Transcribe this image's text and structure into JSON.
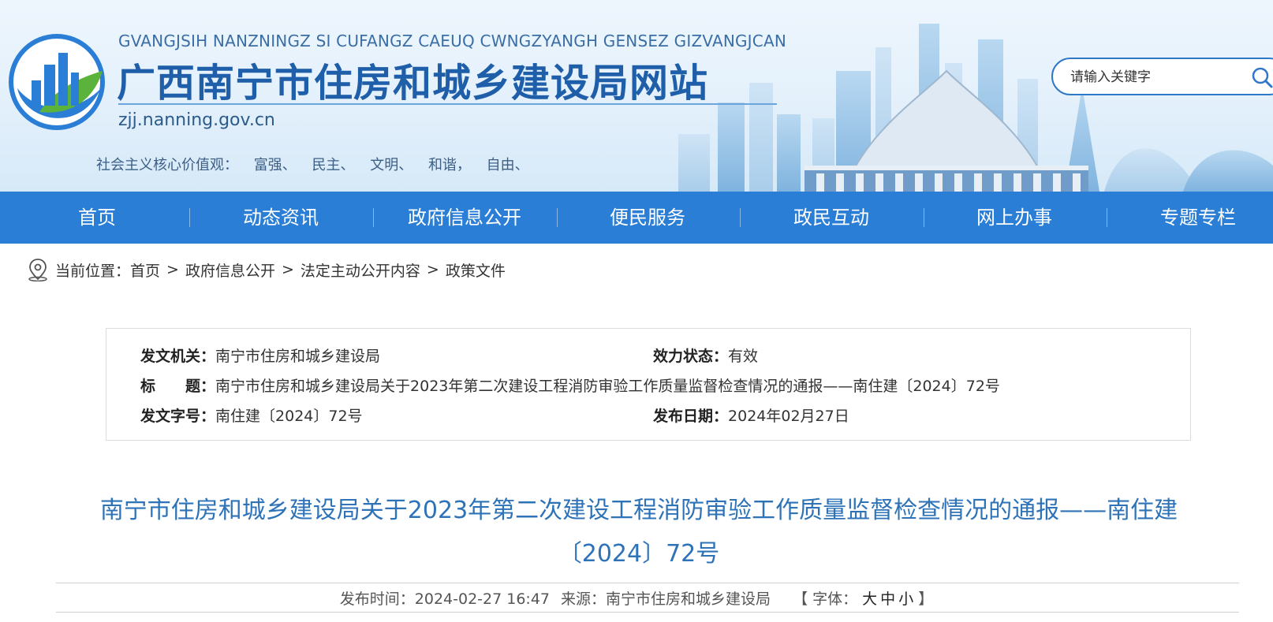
{
  "header": {
    "pinyin": "GVANGJSIH NANZNINGZ SI CUFANGZ CAEUQ CWNGZYANGH GENSEZ GIZVANGJCAN",
    "title": "广西南宁市住房和城乡建设局网站",
    "domain": "zjj.nanning.gov.cn",
    "values_label": "社会主义核心价值观：",
    "values": [
      "富强、",
      "民主、",
      "文明、",
      "和谐，",
      "自由、"
    ]
  },
  "search": {
    "placeholder": "请输入关键字"
  },
  "nav": [
    "首页",
    "动态资讯",
    "政府信息公开",
    "便民服务",
    "政民互动",
    "网上办事",
    "专题专栏"
  ],
  "breadcrumb": {
    "label": "当前位置：",
    "items": [
      "首页",
      "政府信息公开",
      "法定主动公开内容",
      "政策文件"
    ],
    "separator": ">"
  },
  "meta": {
    "issuer_label": "发文机关：",
    "issuer": "南宁市住房和城乡建设局",
    "status_label": "效力状态：",
    "status": "有效",
    "title_label": "标　　题：",
    "title": "南宁市住房和城乡建设局关于2023年第二次建设工程消防审验工作质量监督检查情况的通报——南住建〔2024〕72号",
    "docno_label": "发文字号：",
    "docno": "南住建〔2024〕72号",
    "date_label": "发布日期：",
    "date": "2024年02月27日"
  },
  "article": {
    "title": "南宁市住房和城乡建设局关于2023年第二次建设工程消防审验工作质量监督检查情况的通报——南住建〔2024〕72号",
    "publish_time": "发布时间：2024-02-27 16:47",
    "source": "来源：南宁市住房和城乡建设局",
    "font_label": "【 字体：",
    "font_large": "大",
    "font_medium": "中",
    "font_small": "小",
    "font_end": "】"
  },
  "colors": {
    "nav_bg": "#2a7ed6",
    "title_blue": "#2e73b8",
    "brand_blue": "#1f5ea8"
  }
}
